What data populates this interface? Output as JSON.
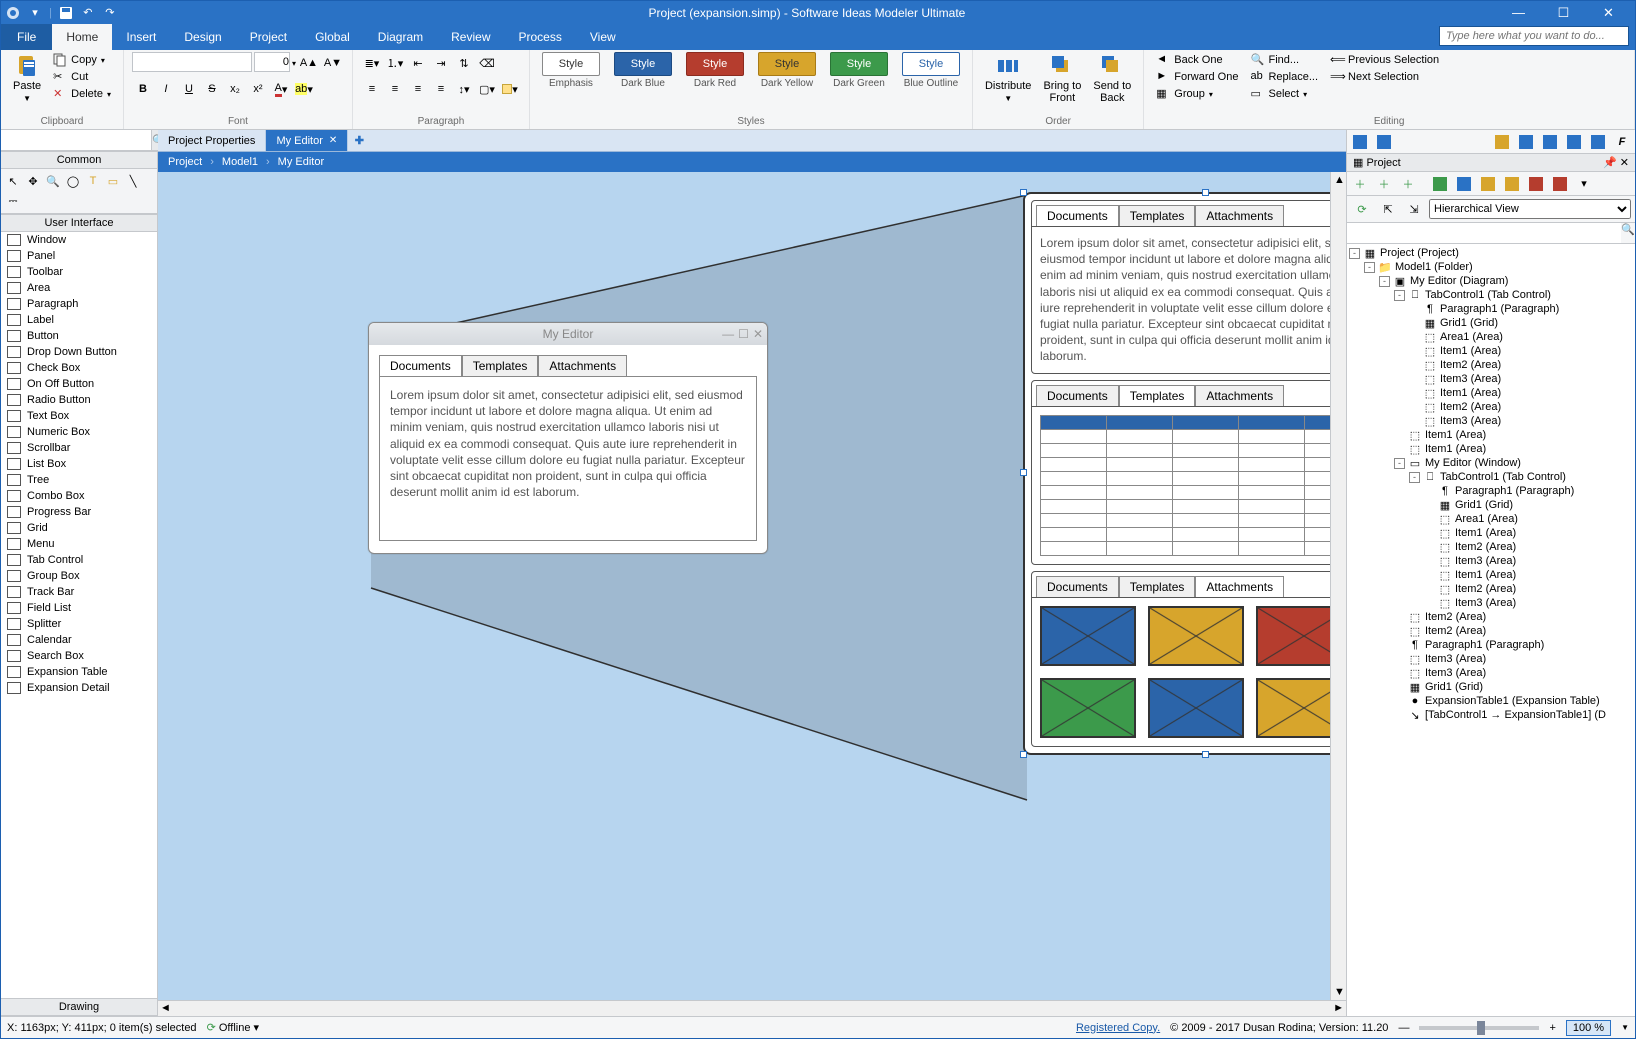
{
  "title": "Project (expansion.simp) - Software Ideas Modeler Ultimate",
  "omnibox_placeholder": "Type here what you want to do...",
  "ribbon_tabs": {
    "file": "File",
    "items": [
      "Home",
      "Insert",
      "Design",
      "Project",
      "Global",
      "Diagram",
      "Review",
      "Process",
      "View"
    ],
    "active": 0
  },
  "clipboard": {
    "paste": "Paste",
    "copy": "Copy",
    "cut": "Cut",
    "delete": "Delete",
    "label": "Clipboard"
  },
  "font": {
    "size": "0",
    "label": "Font"
  },
  "paragraph": {
    "label": "Paragraph"
  },
  "styles": {
    "label": "Styles",
    "items": [
      {
        "name": "Style",
        "sub": "Emphasis",
        "bg": "#ffffff",
        "fg": "#333333",
        "bd": "#888888"
      },
      {
        "name": "Style",
        "sub": "Dark Blue",
        "bg": "#2b64a9",
        "fg": "#ffffff",
        "bd": "#1c4a82"
      },
      {
        "name": "Style",
        "sub": "Dark Red",
        "bg": "#b53d2e",
        "fg": "#ffffff",
        "bd": "#8b2b1f"
      },
      {
        "name": "Style",
        "sub": "Dark Yellow",
        "bg": "#d7a52c",
        "fg": "#333333",
        "bd": "#a87b17"
      },
      {
        "name": "Style",
        "sub": "Dark Green",
        "bg": "#3c9a4b",
        "fg": "#ffffff",
        "bd": "#2a7336"
      },
      {
        "name": "Style",
        "sub": "Blue Outline",
        "bg": "#ffffff",
        "fg": "#2b64a9",
        "bd": "#2b64a9"
      }
    ]
  },
  "order": {
    "distribute": "Distribute",
    "front": "Bring to\nFront",
    "back": "Send to\nBack",
    "label": "Order"
  },
  "editing": {
    "label": "Editing",
    "back": "Back One",
    "forward": "Forward One",
    "group": "Group",
    "find": "Find...",
    "replace": "Replace...",
    "select": "Select",
    "prevsel": "Previous Selection",
    "nextsel": "Next Selection"
  },
  "doctabs": {
    "items": [
      "Project Properties",
      "My Editor"
    ],
    "active": 1
  },
  "breadcrumb": [
    "Project",
    "Model1",
    "My Editor"
  ],
  "toolbox": {
    "common": "Common",
    "ui": "User Interface",
    "drawing": "Drawing",
    "items": [
      "Window",
      "Panel",
      "Toolbar",
      "Area",
      "Paragraph",
      "Label",
      "Button",
      "Drop Down Button",
      "Check Box",
      "On Off Button",
      "Radio Button",
      "Text Box",
      "Numeric Box",
      "Scrollbar",
      "List Box",
      "Tree",
      "Combo Box",
      "Progress Bar",
      "Grid",
      "Menu",
      "Tab Control",
      "Group Box",
      "Track Bar",
      "Field List",
      "Splitter",
      "Calendar",
      "Search Box",
      "Expansion Table",
      "Expansion Detail"
    ]
  },
  "mock": {
    "title": "My Editor",
    "tabs": [
      "Documents",
      "Templates",
      "Attachments"
    ],
    "lorem": "Lorem ipsum dolor sit amet, consectetur adipisici elit, sed eiusmod tempor incidunt ut labore et dolore magna aliqua. Ut enim ad minim veniam, quis nostrud exercitation ullamco laboris nisi ut aliquid ex ea commodi consequat. Quis aute iure reprehenderit in voluptate velit esse cillum dolore eu fugiat nulla pariatur. Excepteur sint obcaecat cupiditat non proident, sunt in culpa qui officia deserunt mollit anim id est laborum."
  },
  "thumb_colors": [
    "#2b64a9",
    "#d7a52c",
    "#b53d2e",
    "#3c9a4b",
    "#2b64a9",
    "#d7a52c"
  ],
  "project_panel": {
    "title": "Project",
    "view": "Hierarchical View",
    "tree": [
      {
        "d": 0,
        "e": "-",
        "i": "proj",
        "t": "Project (Project)"
      },
      {
        "d": 1,
        "e": "-",
        "i": "fold",
        "t": "Model1 (Folder)"
      },
      {
        "d": 2,
        "e": "-",
        "i": "diag",
        "t": "My Editor (Diagram)"
      },
      {
        "d": 3,
        "e": "-",
        "i": "tab",
        "t": "TabControl1 (Tab Control)"
      },
      {
        "d": 4,
        "e": "",
        "i": "para",
        "t": "Paragraph1 (Paragraph)"
      },
      {
        "d": 4,
        "e": "",
        "i": "grid",
        "t": "Grid1 (Grid)"
      },
      {
        "d": 4,
        "e": "",
        "i": "area",
        "t": "Area1 (Area)"
      },
      {
        "d": 4,
        "e": "",
        "i": "area",
        "t": "Item1 (Area)"
      },
      {
        "d": 4,
        "e": "",
        "i": "area",
        "t": "Item2 (Area)"
      },
      {
        "d": 4,
        "e": "",
        "i": "area",
        "t": "Item3 (Area)"
      },
      {
        "d": 4,
        "e": "",
        "i": "area",
        "t": "Item1 (Area)"
      },
      {
        "d": 4,
        "e": "",
        "i": "area",
        "t": "Item2 (Area)"
      },
      {
        "d": 4,
        "e": "",
        "i": "area",
        "t": "Item3 (Area)"
      },
      {
        "d": 3,
        "e": "",
        "i": "area",
        "t": "Item1 (Area)"
      },
      {
        "d": 3,
        "e": "",
        "i": "area",
        "t": "Item1 (Area)"
      },
      {
        "d": 3,
        "e": "-",
        "i": "win",
        "t": "My Editor (Window)"
      },
      {
        "d": 4,
        "e": "-",
        "i": "tab",
        "t": "TabControl1 (Tab Control)"
      },
      {
        "d": 5,
        "e": "",
        "i": "para",
        "t": "Paragraph1 (Paragraph)"
      },
      {
        "d": 5,
        "e": "",
        "i": "grid",
        "t": "Grid1 (Grid)"
      },
      {
        "d": 5,
        "e": "",
        "i": "area",
        "t": "Area1 (Area)"
      },
      {
        "d": 5,
        "e": "",
        "i": "area",
        "t": "Item1 (Area)"
      },
      {
        "d": 5,
        "e": "",
        "i": "area",
        "t": "Item2 (Area)"
      },
      {
        "d": 5,
        "e": "",
        "i": "area",
        "t": "Item3 (Area)"
      },
      {
        "d": 5,
        "e": "",
        "i": "area",
        "t": "Item1 (Area)"
      },
      {
        "d": 5,
        "e": "",
        "i": "area",
        "t": "Item2 (Area)"
      },
      {
        "d": 5,
        "e": "",
        "i": "area",
        "t": "Item3 (Area)"
      },
      {
        "d": 3,
        "e": "",
        "i": "area",
        "t": "Item2 (Area)"
      },
      {
        "d": 3,
        "e": "",
        "i": "area",
        "t": "Item2 (Area)"
      },
      {
        "d": 3,
        "e": "",
        "i": "para",
        "t": "Paragraph1 (Paragraph)"
      },
      {
        "d": 3,
        "e": "",
        "i": "area",
        "t": "Item3 (Area)"
      },
      {
        "d": 3,
        "e": "",
        "i": "area",
        "t": "Item3 (Area)"
      },
      {
        "d": 3,
        "e": "",
        "i": "grid",
        "t": "Grid1 (Grid)"
      },
      {
        "d": 3,
        "e": "",
        "i": "exp",
        "t": "ExpansionTable1 (Expansion Table)"
      },
      {
        "d": 3,
        "e": "",
        "i": "link",
        "t": "[TabControl1 → ExpansionTable1] (D"
      }
    ]
  },
  "status": {
    "coords": "X: 1163px; Y: 411px; 0 item(s) selected",
    "offline": "Offline",
    "reg": "Registered Copy.",
    "ver": "© 2009 - 2017 Dusan Rodina; Version: 11.20",
    "zoom": "100 %"
  }
}
